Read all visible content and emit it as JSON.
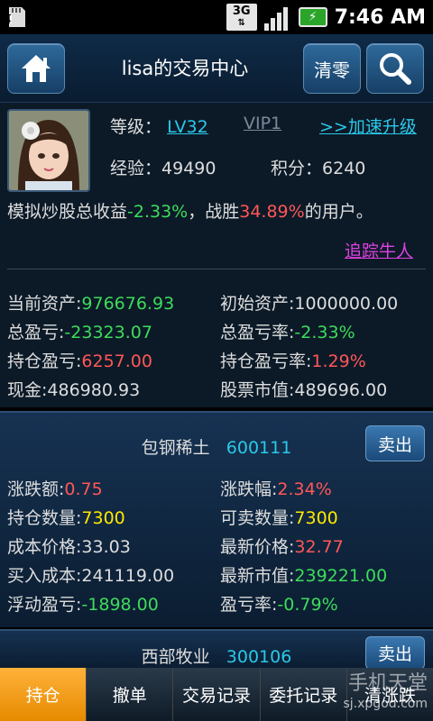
{
  "status": {
    "network": "3G",
    "time": "7:46 AM"
  },
  "header": {
    "title": "lisa的交易中心",
    "clear_label": "清零"
  },
  "profile": {
    "level_label": "等级：",
    "level": "LV32",
    "vip": "VIP1",
    "upgrade": ">>加速升级",
    "exp_label": "经验：",
    "exp": "49490",
    "points_label": "积分：",
    "points": "6240",
    "summary_pre": "模拟炒股总收益",
    "summary_return": "-2.33%",
    "summary_mid": "，战胜",
    "summary_pct": "34.89%",
    "summary_post": "的用户。",
    "track": "追踪牛人"
  },
  "assets": {
    "current_label": "当前资产:",
    "current": "976676.93",
    "initial_label": "初始资产:",
    "initial": "1000000.00",
    "pnl_label": "总盈亏:",
    "pnl": "-23323.07",
    "pnl_rate_label": "总盈亏率:",
    "pnl_rate": "-2.33%",
    "pos_pnl_label": "持仓盈亏:",
    "pos_pnl": "6257.00",
    "pos_pnl_rate_label": "持仓盈亏率:",
    "pos_pnl_rate": "1.29%",
    "cash_label": "现金:",
    "cash": "486980.93",
    "mkt_label": "股票市值:",
    "mkt": "489696.00"
  },
  "stocks": [
    {
      "name": "包钢稀土",
      "code": "600111",
      "sell": "卖出",
      "chg_label": "涨跌额:",
      "chg": "0.75",
      "chg_pct_label": "涨跌幅:",
      "chg_pct": "2.34%",
      "qty_label": "持仓数量:",
      "qty": "7300",
      "sellable_label": "可卖数量:",
      "sellable": "7300",
      "cost_label": "成本价格:",
      "cost": "33.03",
      "latest_label": "最新价格:",
      "latest": "32.77",
      "buy_cost_label": "买入成本:",
      "buy_cost": "241119.00",
      "latest_mv_label": "最新市值:",
      "latest_mv": "239221.00",
      "float_label": "浮动盈亏:",
      "float": "-1898.00",
      "rate_label": "盈亏率:",
      "rate": "-0.79%"
    },
    {
      "name": "西部牧业",
      "code": "300106",
      "sell": "卖出"
    }
  ],
  "tabs": [
    "持仓",
    "撤单",
    "交易记录",
    "委托记录",
    "清涨跌"
  ],
  "watermark": {
    "line1": "手机天堂",
    "line2": "sj.xpgod.com"
  }
}
